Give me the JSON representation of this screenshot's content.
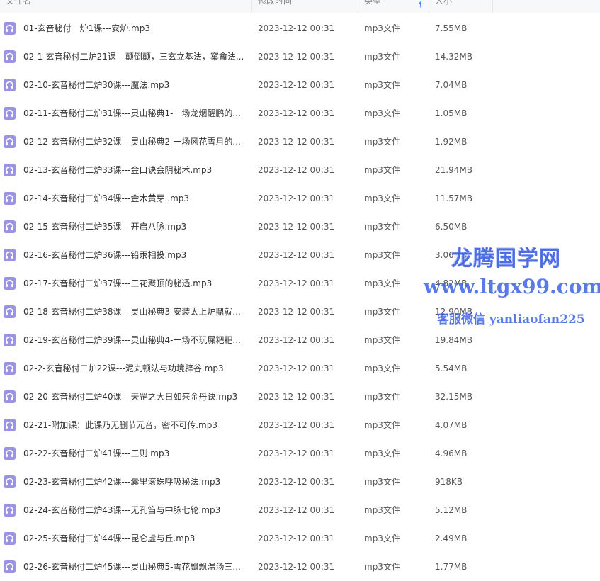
{
  "header": {
    "name_label": "文件名",
    "modified_label": "修改时间",
    "type_label": "类型",
    "size_label": "大小"
  },
  "files": [
    {
      "name": "01-玄音秘付一炉1课---安炉.mp3",
      "modified": "2023-12-12 00:31",
      "type": "mp3文件",
      "size": "7.55MB"
    },
    {
      "name": "02-1-玄音秘付二炉21课---颠倒颠，三玄立基法，窠龠法...",
      "modified": "2023-12-12 00:31",
      "type": "mp3文件",
      "size": "14.32MB"
    },
    {
      "name": "02-10-玄音秘付二炉30课---魔法.mp3",
      "modified": "2023-12-12 00:31",
      "type": "mp3文件",
      "size": "7.04MB"
    },
    {
      "name": "02-11-玄音秘付二炉31课---灵山秘典1-一场龙烟醒鹏的...",
      "modified": "2023-12-12 00:31",
      "type": "mp3文件",
      "size": "1.05MB"
    },
    {
      "name": "02-12-玄音秘付二炉32课---灵山秘典2-一场风花雪月的...",
      "modified": "2023-12-12 00:31",
      "type": "mp3文件",
      "size": "1.92MB"
    },
    {
      "name": "02-13-玄音秘付二炉33课---金口诀会阴秘术.mp3",
      "modified": "2023-12-12 00:31",
      "type": "mp3文件",
      "size": "21.94MB"
    },
    {
      "name": "02-14-玄音秘付二炉34课---金木黄芽..mp3",
      "modified": "2023-12-12 00:31",
      "type": "mp3文件",
      "size": "11.57MB"
    },
    {
      "name": "02-15-玄音秘付二炉35课---开启八脉.mp3",
      "modified": "2023-12-12 00:31",
      "type": "mp3文件",
      "size": "6.50MB"
    },
    {
      "name": "02-16-玄音秘付二炉36课---铅汞相投.mp3",
      "modified": "2023-12-12 00:31",
      "type": "mp3文件",
      "size": "3.06MB"
    },
    {
      "name": "02-17-玄音秘付二炉37课---三花聚顶的秘透.mp3",
      "modified": "2023-12-12 00:31",
      "type": "mp3文件",
      "size": "4.82MB"
    },
    {
      "name": "02-18-玄音秘付二炉38课---灵山秘典3-安装太上炉鼎就...",
      "modified": "2023-12-12 00:31",
      "type": "mp3文件",
      "size": "12.90MB"
    },
    {
      "name": "02-19-玄音秘付二炉39课---灵山秘典4-一场不玩屎粑粑...",
      "modified": "2023-12-12 00:31",
      "type": "mp3文件",
      "size": "19.84MB"
    },
    {
      "name": "02-2-玄音秘付二炉22课---泥丸顿法与功境辟谷.mp3",
      "modified": "2023-12-12 00:31",
      "type": "mp3文件",
      "size": "5.54MB"
    },
    {
      "name": "02-20-玄音秘付二炉40课---天罡之大日如来金丹诀.mp3",
      "modified": "2023-12-12 00:31",
      "type": "mp3文件",
      "size": "32.15MB"
    },
    {
      "name": "02-21-附加课：此课乃无删节元音，密不可传.mp3",
      "modified": "2023-12-12 00:31",
      "type": "mp3文件",
      "size": "4.07MB"
    },
    {
      "name": "02-22-玄音秘付二炉41课---三则.mp3",
      "modified": "2023-12-12 00:31",
      "type": "mp3文件",
      "size": "4.96MB"
    },
    {
      "name": "02-23-玄音秘付二炉42课---囊里滚珠呼吸秘法.mp3",
      "modified": "2023-12-12 00:31",
      "type": "mp3文件",
      "size": "918KB"
    },
    {
      "name": "02-24-玄音秘付二炉43课---无孔笛与中脉七轮.mp3",
      "modified": "2023-12-12 00:31",
      "type": "mp3文件",
      "size": "5.12MB"
    },
    {
      "name": "02-25-玄音秘付二炉44课---昆仑虚与丘.mp3",
      "modified": "2023-12-12 00:31",
      "type": "mp3文件",
      "size": "2.49MB"
    },
    {
      "name": "02-26-玄音秘付二炉45课---灵山秘典5-雪花飘飘温汤三...",
      "modified": "2023-12-12 00:31",
      "type": "mp3文件",
      "size": "1.77MB"
    }
  ],
  "watermark": {
    "title": "龙腾国学网",
    "url": "www.ltgx99.com",
    "contact": "客服微信 yanliaofan225"
  },
  "colors": {
    "file_icon": "#9a93e6",
    "sort_arrow": "#3b8cff",
    "watermark": "#3d63e3"
  },
  "icons": {
    "file": "audio-file-icon",
    "sort": "sort-ascending-icon"
  }
}
